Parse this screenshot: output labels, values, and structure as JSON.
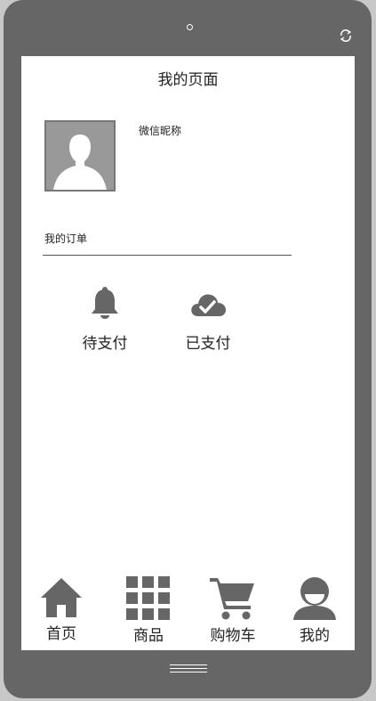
{
  "header": {
    "title": "我的页面"
  },
  "profile": {
    "nickname": "微信昵称"
  },
  "orders": {
    "label": "我的订单",
    "items": [
      {
        "label": "待支付",
        "icon": "bell-icon"
      },
      {
        "label": "已支付",
        "icon": "cloud-check-icon"
      }
    ]
  },
  "tabbar": {
    "items": [
      {
        "label": "首页",
        "icon": "home-icon"
      },
      {
        "label": "商品",
        "icon": "grid-icon"
      },
      {
        "label": "购物车",
        "icon": "cart-icon"
      },
      {
        "label": "我的",
        "icon": "user-icon"
      }
    ]
  },
  "colors": {
    "frame": "#666666",
    "icon": "#666666",
    "screen": "#ffffff"
  }
}
